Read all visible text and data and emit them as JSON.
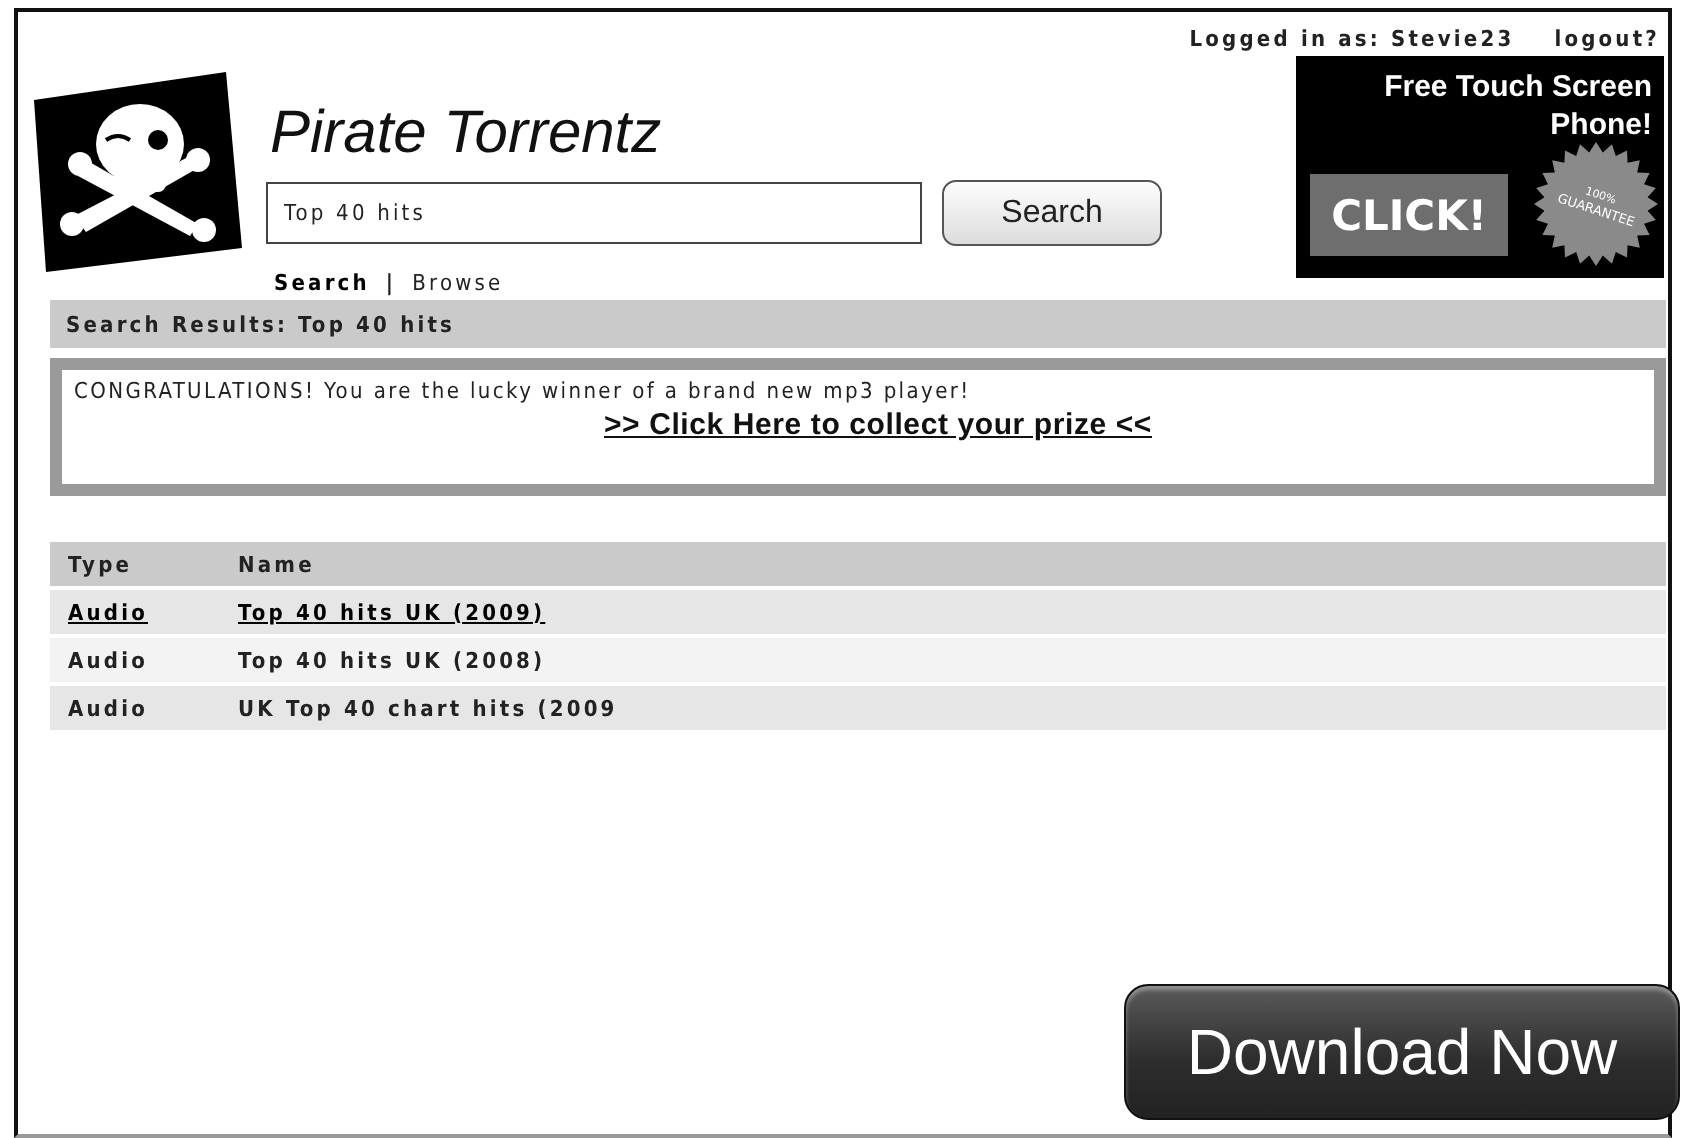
{
  "user": {
    "label": "Logged in as:",
    "username": "Stevie23",
    "logout": "logout?"
  },
  "site": {
    "title": "Pirate Torrentz"
  },
  "search": {
    "value": "Top 40 hits",
    "button": "Search"
  },
  "nav": [
    {
      "label": "Search",
      "selected": true
    },
    {
      "label": "Browse",
      "selected": false
    }
  ],
  "nav_separator": "|",
  "ad": {
    "headline": "Free Touch Screen Phone!",
    "cta": "CLICK!",
    "seal": [
      "100%",
      "GUARANTEE"
    ]
  },
  "results_title": "Search Results: Top 40 hits",
  "prize": {
    "message": "CONGRATULATIONS! You are the lucky winner of a brand new mp3 player!",
    "link": ">> Click Here to collect your prize <<"
  },
  "table": {
    "columns": [
      "Type",
      "Name"
    ],
    "rows": [
      {
        "type": "Audio",
        "name": "Top 40 hits UK (2009)",
        "selected": true
      },
      {
        "type": "Audio",
        "name": "Top 40 hits UK (2008)",
        "selected": false
      },
      {
        "type": "Audio",
        "name": "UK Top 40 chart hits (2009",
        "selected": false
      }
    ]
  },
  "download_button": "Download Now"
}
